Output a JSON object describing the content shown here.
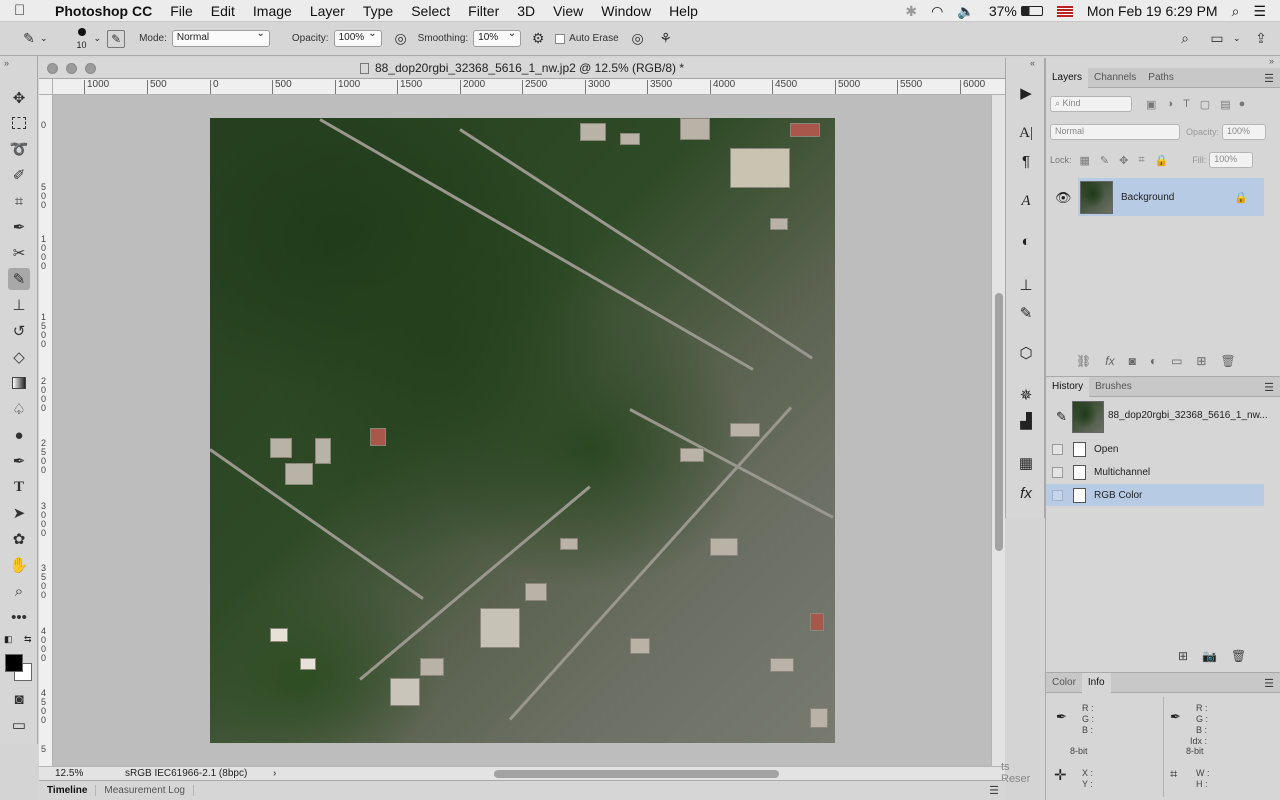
{
  "menubar": {
    "app_name": "Photoshop CC",
    "items": [
      "File",
      "Edit",
      "Image",
      "Layer",
      "Type",
      "Select",
      "Filter",
      "3D",
      "View",
      "Window",
      "Help"
    ],
    "battery": "37%",
    "datetime": "Mon Feb 19  6:29 PM"
  },
  "options_bar": {
    "brush_size": "10",
    "mode_label": "Mode:",
    "mode_value": "Normal",
    "opacity_label": "Opacity:",
    "opacity_value": "100%",
    "smoothing_label": "Smoothing:",
    "smoothing_value": "10%",
    "auto_erase_label": "Auto Erase"
  },
  "document": {
    "title": "88_dop20rgbi_32368_5616_1_nw.jp2 @ 12.5% (RGB/8) *",
    "zoom": "12.5%",
    "profile": "sRGB IEC61966-2.1 (8bpc)",
    "h_ruler": [
      "1000",
      "500",
      "0",
      "500",
      "1000",
      "1500",
      "2000",
      "2500",
      "3000",
      "3500",
      "4000",
      "4500",
      "5000",
      "5500",
      "6000"
    ],
    "v_ruler": [
      "0",
      "500",
      "1000",
      "1500",
      "2000",
      "2500",
      "3000",
      "3500",
      "4000",
      "4500",
      "5"
    ],
    "partial_text": "ts Reser"
  },
  "bottom_tabs": [
    "Timeline",
    "Measurement Log"
  ],
  "layers_panel": {
    "tabs": [
      "Layers",
      "Channels",
      "Paths"
    ],
    "kind_placeholder": "Kind",
    "blend_mode": "Normal",
    "opacity_label": "Opacity:",
    "opacity_value": "100%",
    "lock_label": "Lock:",
    "fill_label": "Fill:",
    "fill_value": "100%",
    "layer_name": "Background"
  },
  "history_panel": {
    "tabs": [
      "History",
      "Brushes"
    ],
    "snapshot": "88_dop20rgbi_32368_5616_1_nw...",
    "items": [
      "Open",
      "Multichannel",
      "RGB Color"
    ]
  },
  "info_panel": {
    "tabs": [
      "Color",
      "Info"
    ],
    "rgb_labels": [
      "R :",
      "G :",
      "B :"
    ],
    "rgb_labels_right": [
      "R :",
      "G :",
      "B :",
      "Idx :"
    ],
    "bit_depth": "8-bit",
    "xy_labels": [
      "X :",
      "Y :"
    ],
    "wh_labels": [
      "W :",
      "H :"
    ]
  }
}
